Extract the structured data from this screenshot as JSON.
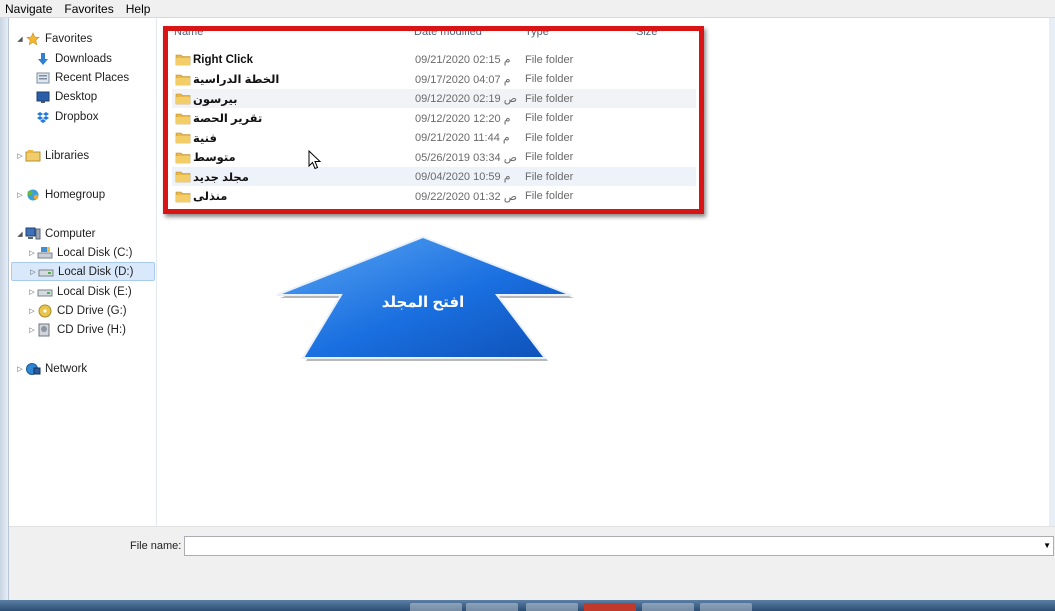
{
  "menu": [
    "Navigate",
    "Favorites",
    "Help"
  ],
  "nav": {
    "favorites": "Favorites",
    "downloads": "Downloads",
    "recent": "Recent Places",
    "desktop": "Desktop",
    "dropbox": "Dropbox",
    "libraries": "Libraries",
    "homegroup": "Homegroup",
    "computer": "Computer",
    "disk_c": "Local Disk (C:)",
    "disk_d": "Local Disk (D:)",
    "disk_e": "Local Disk (E:)",
    "cd_g": "CD Drive (G:)",
    "cd_h": "CD Drive (H:)",
    "network": "Network"
  },
  "columns": {
    "name": "Name",
    "date": "Date modified",
    "type": "Type",
    "size": "Size"
  },
  "files": [
    {
      "name": "Right Click",
      "date": "09/21/2020 02:15 م",
      "type": "File folder"
    },
    {
      "name": "الخطة الدراسية",
      "date": "09/17/2020 04:07 م",
      "type": "File folder"
    },
    {
      "name": "بيرسون",
      "date": "09/12/2020 02:19 ص",
      "type": "File folder"
    },
    {
      "name": "تقرير الحصة",
      "date": "09/12/2020 12:20 م",
      "type": "File folder"
    },
    {
      "name": "فنية",
      "date": "09/21/2020 11:44 م",
      "type": "File folder"
    },
    {
      "name": "متوسط",
      "date": "05/26/2019 03:34 ص",
      "type": "File folder"
    },
    {
      "name": "مجلد جديد",
      "date": "09/04/2020 10:59 م",
      "type": "File folder"
    },
    {
      "name": "منذلى",
      "date": "09/22/2020 01:32 ص",
      "type": "File folder"
    }
  ],
  "callout": {
    "text": "افتح المجلد",
    "color": "#1565d8"
  },
  "filename": {
    "label": "File name:",
    "value": ""
  },
  "colors": {
    "highlight_frame": "#d91414",
    "selection": "#d9e9fb"
  }
}
